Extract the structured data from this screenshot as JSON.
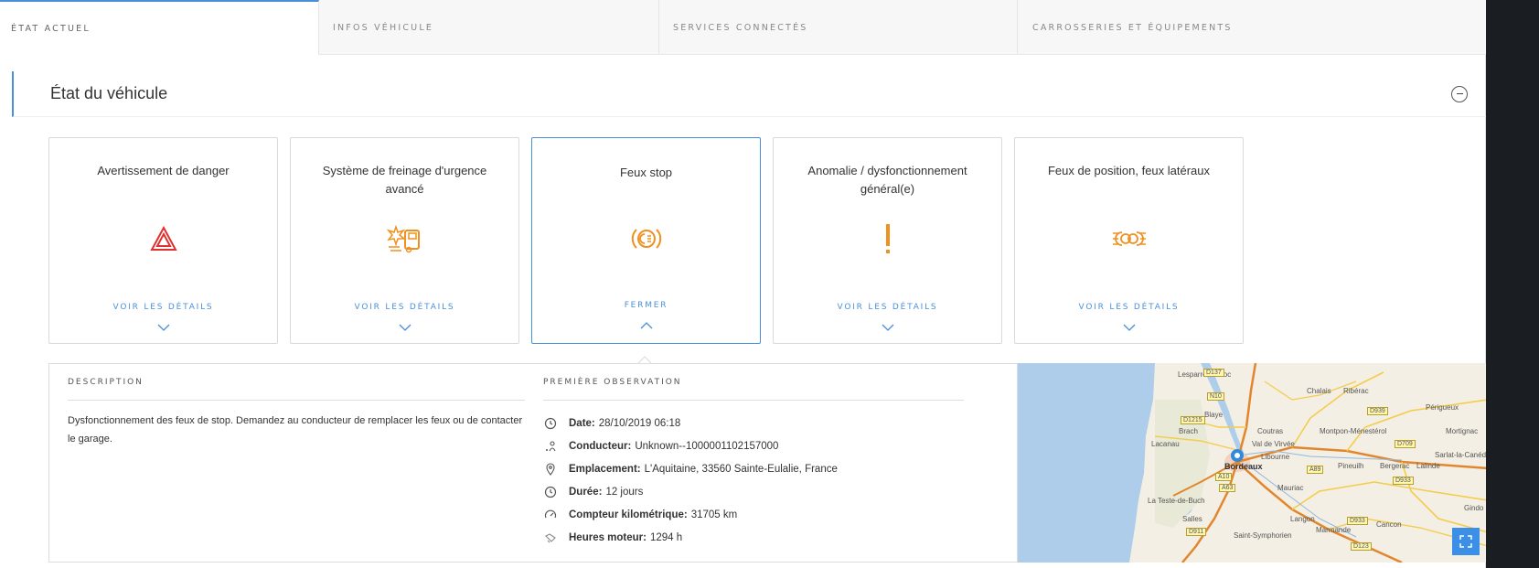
{
  "tabs": [
    {
      "label": "ÉTAT ACTUEL",
      "active": true
    },
    {
      "label": "INFOS VÉHICULE",
      "active": false
    },
    {
      "label": "SERVICES CONNECTÉS",
      "active": false
    },
    {
      "label": "CARROSSERIES ET ÉQUIPEMENTS",
      "active": false
    }
  ],
  "section": {
    "title": "État du véhicule"
  },
  "cards": [
    {
      "title": "Avertissement de danger",
      "link": "VOIR LES DÉTAILS",
      "icon": "hazard-triangle-icon",
      "icon_color": "#e03030"
    },
    {
      "title": "Système de freinage d'urgence avancé",
      "link": "VOIR LES DÉTAILS",
      "icon": "emergency-brake-icon",
      "icon_color": "#f0901e"
    },
    {
      "title": "Feux stop",
      "link": "FERMER",
      "icon": "brake-light-icon",
      "icon_color": "#f0901e",
      "selected": true
    },
    {
      "title": "Anomalie / dysfonctionnement général(e)",
      "link": "VOIR LES DÉTAILS",
      "icon": "exclamation-icon",
      "icon_color": "#f0901e"
    },
    {
      "title": "Feux de position, feux latéraux",
      "link": "VOIR LES DÉTAILS",
      "icon": "position-lights-icon",
      "icon_color": "#f0901e"
    }
  ],
  "details": {
    "description_heading": "DESCRIPTION",
    "description": "Dysfonctionnement des feux de stop. Demandez au conducteur de remplacer les feux ou de contacter le garage.",
    "observation_heading": "PREMIÈRE OBSERVATION",
    "observations": [
      {
        "label": "Date:",
        "value": "28/10/2019 06:18",
        "icon": "clock-icon"
      },
      {
        "label": "Conducteur:",
        "value": "Unknown--1000001102157000",
        "icon": "driver-icon"
      },
      {
        "label": "Emplacement:",
        "value": "L'Aquitaine, 33560 Sainte-Eulalie, France",
        "icon": "location-pin-icon"
      },
      {
        "label": "Durée:",
        "value": "12 jours",
        "icon": "duration-clock-icon"
      },
      {
        "label": "Compteur kilométrique:",
        "value": "31705 km",
        "icon": "odometer-icon"
      },
      {
        "label": "Heures moteur:",
        "value": "1294 h",
        "icon": "engine-hours-icon"
      }
    ]
  },
  "map": {
    "cities": [
      "Bordeaux"
    ],
    "places": [
      "Lesparre-Médoc",
      "Chalais",
      "Ribérac",
      "Périgueux",
      "Blaye",
      "Brach",
      "Coutras",
      "Montpon-Ménestérol",
      "Mortignac",
      "Lacanau",
      "Val de Virvée",
      "Libourne",
      "Sarlat-la-Canéda",
      "Pineuilh",
      "Bergerac",
      "Lalinde",
      "Mauriac",
      "La Teste-de-Buch",
      "Salles",
      "Langon",
      "Marmande",
      "Cancon",
      "Saint-Symphorien",
      "Gindo"
    ],
    "roads": [
      "D1215",
      "D137",
      "N10",
      "D1215",
      "D939",
      "D709",
      "A10",
      "A89",
      "A63",
      "D933",
      "D933",
      "A65",
      "D911",
      "D660",
      "A62",
      "D123"
    ]
  },
  "colors": {
    "accent": "#4a90d9",
    "warning": "#f0901e",
    "danger": "#e03030"
  }
}
